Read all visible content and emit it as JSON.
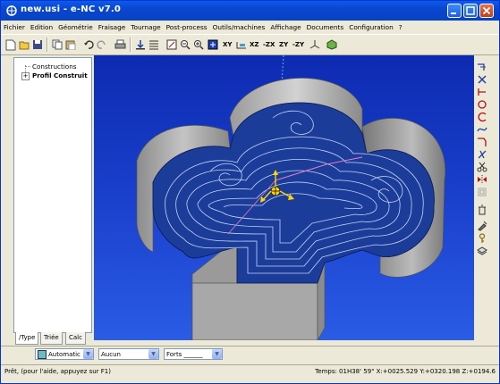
{
  "window": {
    "title": "new.usi - e-NC v7.0"
  },
  "menu": [
    "Fichier",
    "Edition",
    "Géométrie",
    "Fraisage",
    "Tournage",
    "Post-process",
    "Outils/machines",
    "Affichage",
    "Documents",
    "Configuration",
    "?"
  ],
  "toolbar": {
    "view_labels": [
      "XY",
      "XZ",
      "-ZX",
      "ZY",
      "-ZY"
    ]
  },
  "tree": {
    "root": "Constructions",
    "child": "Profil Construit"
  },
  "tabs": [
    "/Type",
    "Triée",
    "Calc"
  ],
  "bottom": {
    "color_value": "Automatic",
    "combo2_value": "Aucun",
    "combo3_value": "Forts ______"
  },
  "status": {
    "left": "Prêt, (pour l'aide, appuyez sur F1)",
    "right": "Temps: 01H38' 59\" X:+0025.529 Y:+0320.198 Z:+0194.6"
  }
}
